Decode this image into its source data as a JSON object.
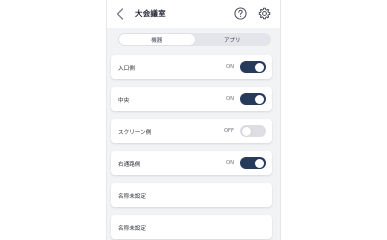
{
  "header": {
    "title": "大会議室"
  },
  "segment": {
    "options": [
      "機器",
      "アプリ"
    ],
    "selected": "機器"
  },
  "rows": [
    {
      "label": "入口側",
      "state": "ON",
      "on": true
    },
    {
      "label": "中央",
      "state": "ON",
      "on": true
    },
    {
      "label": "スクリーン側",
      "state": "OFF",
      "on": false
    },
    {
      "label": "右通路側",
      "state": "ON",
      "on": true
    },
    {
      "label": "名称未設定"
    },
    {
      "label": "名称未設定"
    }
  ],
  "colors": {
    "toggle_on": "#283a59",
    "toggle_off": "#dcdee3",
    "background": "#f2f3f5"
  },
  "icons": [
    "chevron-left-icon",
    "help-circle-icon",
    "gear-icon"
  ]
}
